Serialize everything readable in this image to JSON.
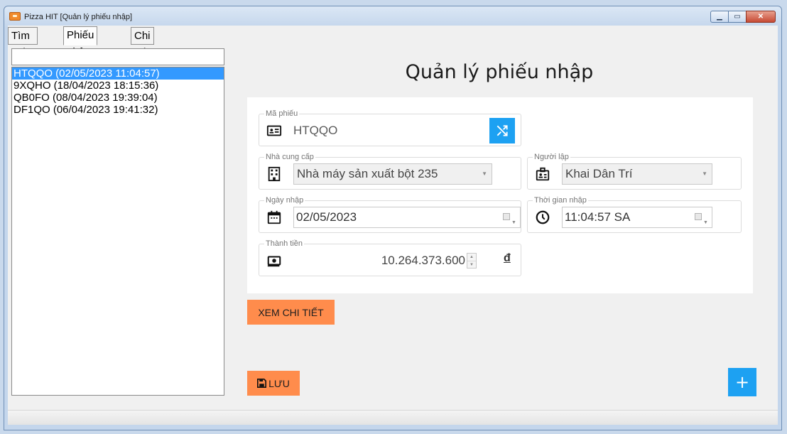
{
  "window": {
    "title": "Pizza HIT [Quản lý phiếu nhập]",
    "controls": {
      "minimize": "▭",
      "maximize": "▭",
      "close": "✕"
    }
  },
  "tabs": [
    {
      "label": "Tìm kiếm",
      "active": false
    },
    {
      "label": "Phiếu nhập",
      "active": true
    },
    {
      "label": "Chi tiết",
      "active": false
    }
  ],
  "search": {
    "value": ""
  },
  "list": {
    "items": [
      {
        "label": "HTQQO (02/05/2023 11:04:57)",
        "selected": true
      },
      {
        "label": "9XQHO (18/04/2023 18:15:36)",
        "selected": false
      },
      {
        "label": "QB0FO (08/04/2023 19:39:04)",
        "selected": false
      },
      {
        "label": "DF1QO (06/04/2023 19:41:32)",
        "selected": false
      }
    ]
  },
  "page": {
    "title": "Quản lý phiếu nhập"
  },
  "form": {
    "ma_phieu": {
      "label": "Mã phiếu",
      "value": "HTQQO",
      "icon": "id-card-icon"
    },
    "nha_cung_cap": {
      "label": "Nhà cung cấp",
      "value": "Nhà máy sản xuất bột 235",
      "icon": "building-icon"
    },
    "nguoi_lap": {
      "label": "Người lập",
      "value": "Khai Dân Trí",
      "icon": "badge-icon"
    },
    "ngay_nhap": {
      "label": "Ngày nhập",
      "value": "02/05/2023",
      "icon": "calendar-icon"
    },
    "thoi_gian_nhap": {
      "label": "Thời gian nhập",
      "value": "11:04:57 SA",
      "icon": "clock-icon"
    },
    "thanh_tien": {
      "label": "Thành tiền",
      "value": "10.264.373.600",
      "currency": "đ",
      "icon": "money-icon"
    }
  },
  "buttons": {
    "xem_chi_tiet": "XEM CHI TIẾT",
    "luu": "LƯU",
    "add": "+"
  },
  "colors": {
    "accent_blue": "#1da1f2",
    "accent_orange": "#ff8c4c",
    "selection": "#3399ff"
  }
}
